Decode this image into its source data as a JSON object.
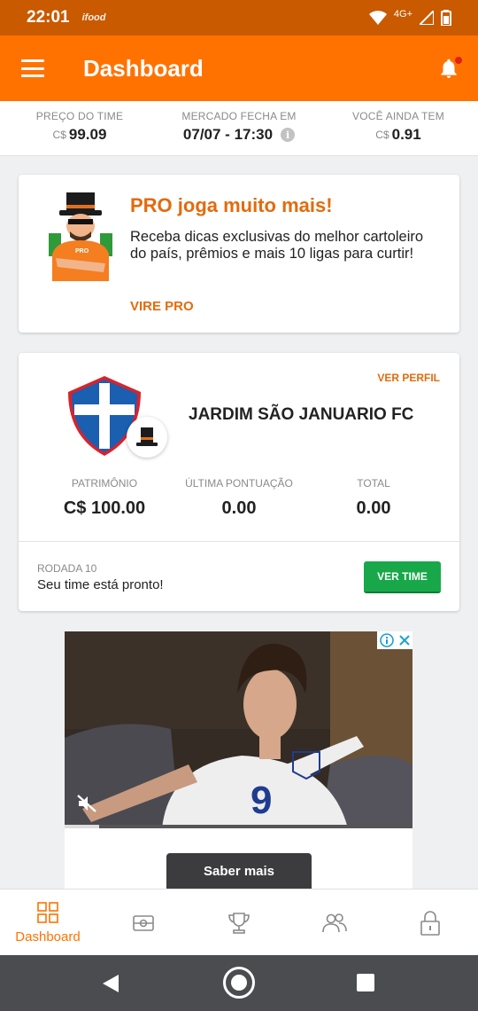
{
  "status_bar": {
    "time": "22:01",
    "left_icon": "ifood",
    "network": "4G+"
  },
  "app_bar": {
    "title": "Dashboard"
  },
  "stats": [
    {
      "label": "PREÇO DO TIME",
      "currency": "C$",
      "value": "99.09"
    },
    {
      "label": "MERCADO FECHA EM",
      "value": "07/07 - 17:30"
    },
    {
      "label": "VOCÊ AINDA TEM",
      "currency": "C$",
      "value": "0.91"
    }
  ],
  "promo": {
    "title": "PRO joga muito mais!",
    "text": "Receba dicas exclusivas do melhor cartoleiro do país, prêmios e mais 10 ligas para curtir!",
    "link": "VIRE PRO"
  },
  "team": {
    "profile_link": "VER PERFIL",
    "name": "JARDIM SÃO JANUARIO FC",
    "stats": [
      {
        "label": "PATRIMÔNIO",
        "value": "C$ 100.00"
      },
      {
        "label": "ÚLTIMA PONTUAÇÃO",
        "value": "0.00"
      },
      {
        "label": "TOTAL",
        "value": "0.00"
      }
    ],
    "round_label": "RODADA 10",
    "round_text": "Seu time está pronto!",
    "button": "VER TIME",
    "shield_colors": {
      "blue": "#1a5fb0",
      "red": "#d9222c",
      "white": "#ffffff"
    }
  },
  "ad": {
    "cta": "Saber mais",
    "jersey_number": "9",
    "progress": 0.1
  },
  "bottom_nav": [
    {
      "icon": "dashboard-icon",
      "label": "Dashboard",
      "active": true
    },
    {
      "icon": "field-icon"
    },
    {
      "icon": "trophy-icon"
    },
    {
      "icon": "people-icon"
    },
    {
      "icon": "lock-icon"
    }
  ],
  "colors": {
    "primary": "#ff7200",
    "status_bar": "#c95a00",
    "accent_text": "#e36b0d",
    "success": "#18a84a"
  }
}
